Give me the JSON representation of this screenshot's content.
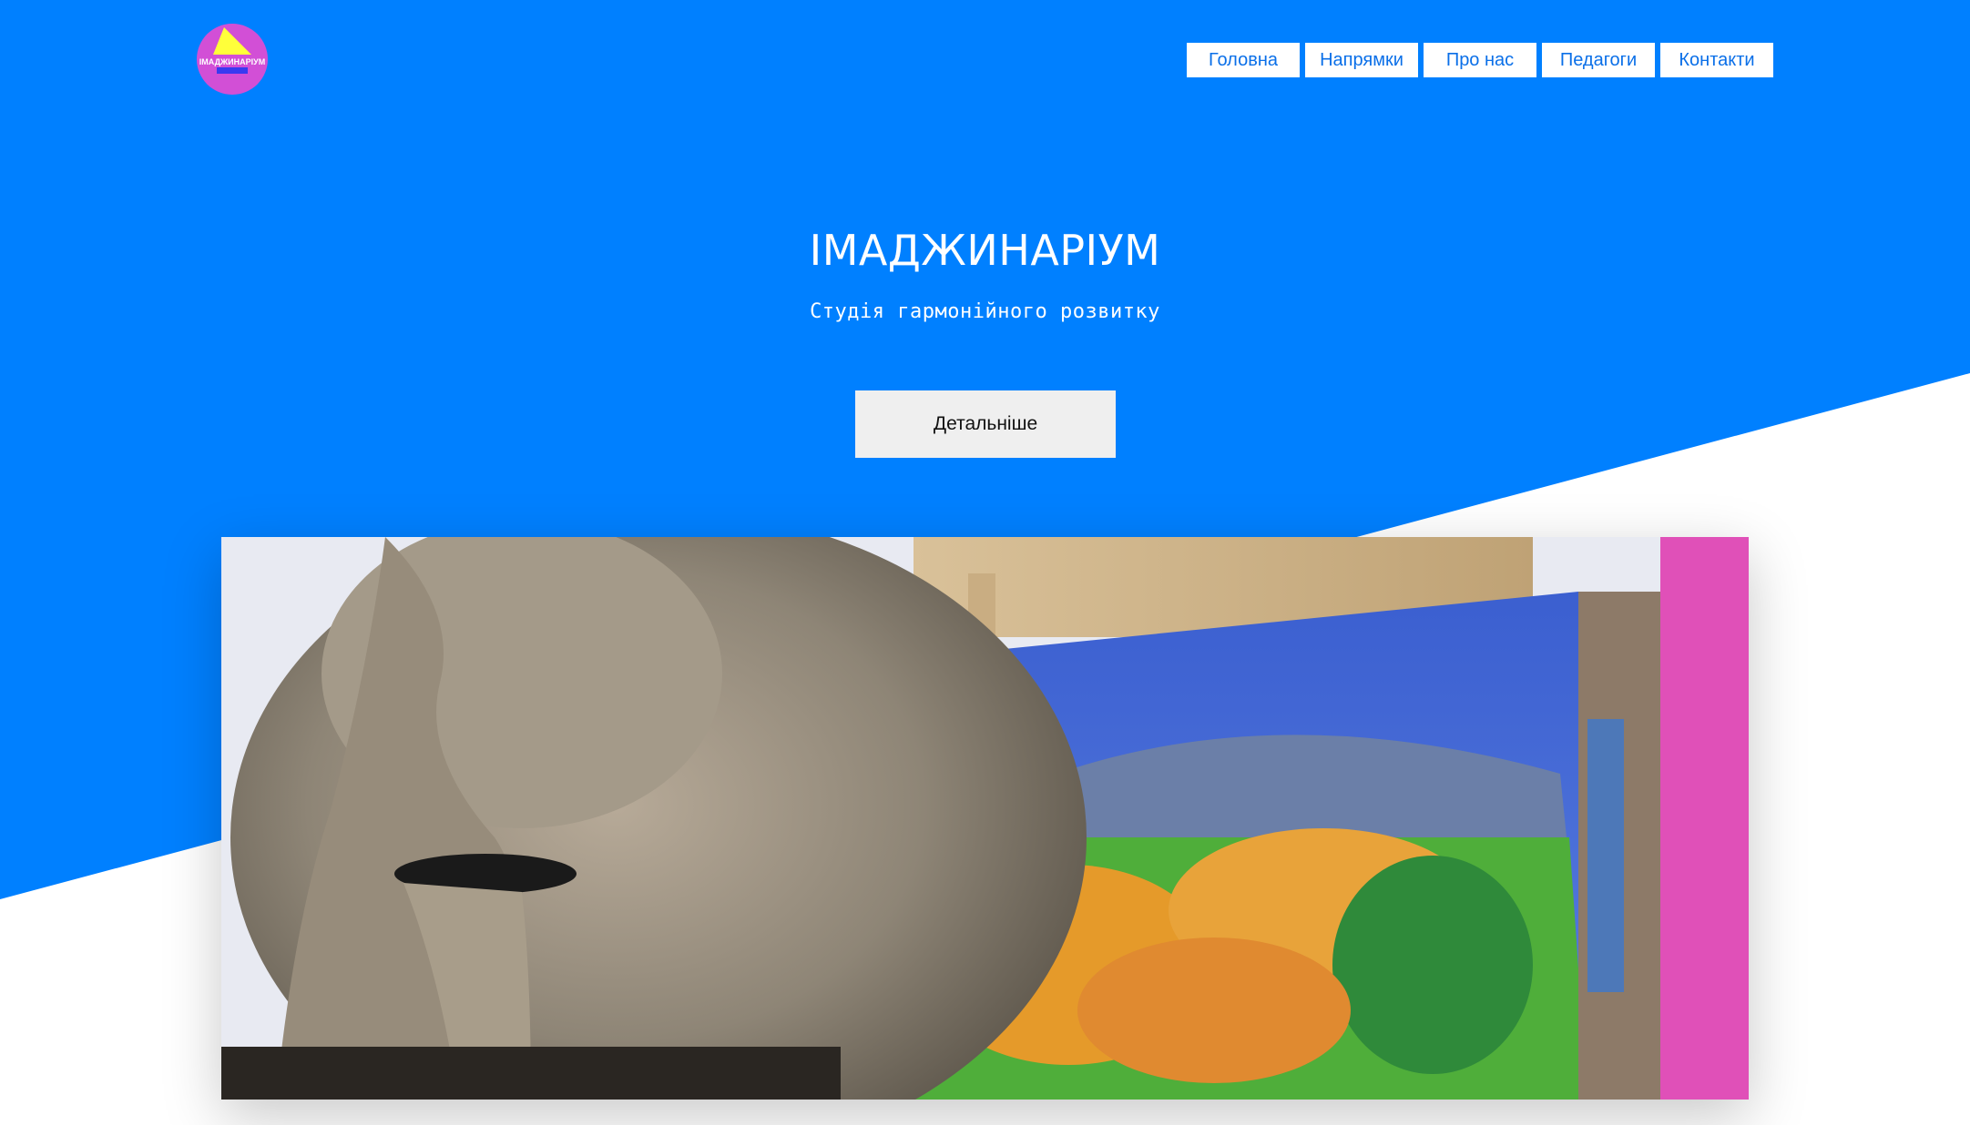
{
  "brand": {
    "logo_text": "ІМАДЖИНАРІУМ",
    "colors": {
      "primary": "#0080ff",
      "logo_circle": "#d24fd6",
      "logo_triangle": "#ffff3a",
      "logo_bar": "#3a3af0"
    }
  },
  "nav": {
    "items": [
      {
        "label": "Головна"
      },
      {
        "label": "Напрямки"
      },
      {
        "label": "Про нас"
      },
      {
        "label": "Педагоги"
      },
      {
        "label": "Контакти"
      }
    ]
  },
  "hero": {
    "title": "ІМАДЖИНАРІУМ",
    "subtitle": "Студія гармонійного розвитку",
    "button_label": "Детальніше",
    "image_alt_icon": "painting-photo"
  }
}
